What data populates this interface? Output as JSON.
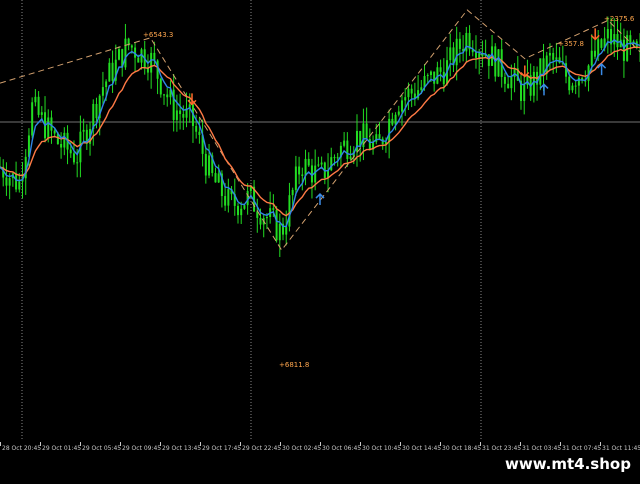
{
  "watermark": "www.mt4.shop",
  "colors": {
    "background": "#000000",
    "candle": "#22dd22",
    "ma_fast": "#2f86e6",
    "ma_slow": "#ff7a45",
    "zigzag": "#d2a06e",
    "arrow_up": "#3a8ae6",
    "arrow_down": "#ff6a2a",
    "grid": "#bfbfbf",
    "label": "#ffa64d",
    "axis_text": "#c8c8c8"
  },
  "chart_data": {
    "type": "candlestick",
    "grid": "vertical dotted",
    "x_tick_labels": [
      "28 Oct 20:45",
      "29 Oct 01:45",
      "29 Oct 05:45",
      "29 Oct 09:45",
      "29 Oct 13:45",
      "29 Oct 17:45",
      "29 Oct 22:45",
      "30 Oct 02:45",
      "30 Oct 06:45",
      "30 Oct 10:45",
      "30 Oct 14:45",
      "30 Oct 18:45",
      "31 Oct 23:45",
      "31 Oct 03:45",
      "31 Oct 07:45",
      "31 Oct 11:45"
    ],
    "swing_labels": [
      "+6543.3",
      "+6811.8",
      "+357.8",
      "+2375.6"
    ],
    "zigzag_swings": [
      {
        "t": 0,
        "p": 0.79
      },
      {
        "t": 0.235,
        "p": 0.92
      },
      {
        "t": 0.44,
        "p": 0.31
      },
      {
        "t": 0.73,
        "p": 1.0
      },
      {
        "t": 0.82,
        "p": 0.86
      },
      {
        "t": 0.95,
        "p": 0.97
      },
      {
        "t": 1.0,
        "p": 0.88
      }
    ],
    "price_path": [
      {
        "t": 0,
        "p": 0.55
      },
      {
        "t": 0.03,
        "p": 0.5
      },
      {
        "t": 0.05,
        "p": 0.72
      },
      {
        "t": 0.09,
        "p": 0.62
      },
      {
        "t": 0.12,
        "p": 0.58
      },
      {
        "t": 0.16,
        "p": 0.78
      },
      {
        "t": 0.2,
        "p": 0.9
      },
      {
        "t": 0.235,
        "p": 0.86
      },
      {
        "t": 0.27,
        "p": 0.72
      },
      {
        "t": 0.3,
        "p": 0.68
      },
      {
        "t": 0.33,
        "p": 0.52
      },
      {
        "t": 0.36,
        "p": 0.44
      },
      {
        "t": 0.39,
        "p": 0.46
      },
      {
        "t": 0.42,
        "p": 0.4
      },
      {
        "t": 0.44,
        "p": 0.36
      },
      {
        "t": 0.47,
        "p": 0.56
      },
      {
        "t": 0.5,
        "p": 0.52
      },
      {
        "t": 0.53,
        "p": 0.6
      },
      {
        "t": 0.56,
        "p": 0.64
      },
      {
        "t": 0.59,
        "p": 0.6
      },
      {
        "t": 0.62,
        "p": 0.74
      },
      {
        "t": 0.66,
        "p": 0.78
      },
      {
        "t": 0.7,
        "p": 0.84
      },
      {
        "t": 0.73,
        "p": 0.93
      },
      {
        "t": 0.76,
        "p": 0.88
      },
      {
        "t": 0.79,
        "p": 0.82
      },
      {
        "t": 0.82,
        "p": 0.76
      },
      {
        "t": 0.86,
        "p": 0.86
      },
      {
        "t": 0.89,
        "p": 0.8
      },
      {
        "t": 0.92,
        "p": 0.84
      },
      {
        "t": 0.95,
        "p": 0.92
      },
      {
        "t": 1.0,
        "p": 0.86
      }
    ],
    "signal_arrows": [
      {
        "dir": "down",
        "t": 0.3
      },
      {
        "dir": "up",
        "t": 0.5
      },
      {
        "dir": "down",
        "t": 0.82
      },
      {
        "dir": "up",
        "t": 0.85
      },
      {
        "dir": "down",
        "t": 0.93
      },
      {
        "dir": "up",
        "t": 0.94
      }
    ]
  }
}
